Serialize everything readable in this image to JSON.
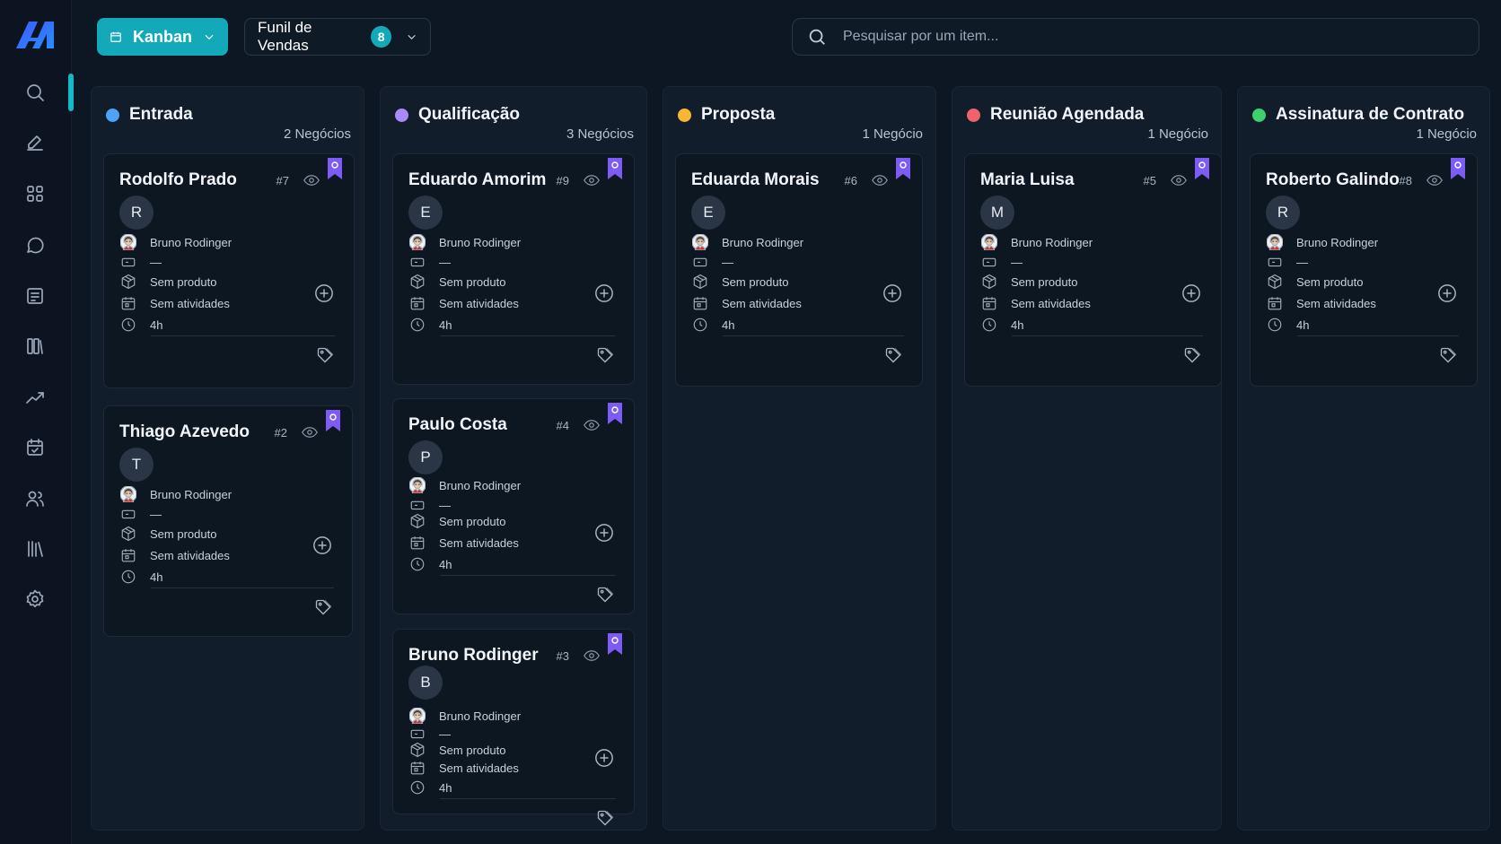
{
  "toolbar": {
    "view_label": "Kanban",
    "funnel_label": "Funil de Vendas",
    "funnel_count": "8",
    "search_placeholder": "Pesquisar por um item..."
  },
  "sidebar": {
    "items": [
      "search-icon",
      "edit-icon",
      "grid-icon",
      "chat-icon",
      "notes-icon",
      "books-icon",
      "trend-icon",
      "calendar-icon",
      "users-icon",
      "library-icon",
      "settings-icon"
    ]
  },
  "colors": {
    "accent": "#14a9b8",
    "entrada": "#4ea3f5",
    "qualificacao": "#a78bfa",
    "proposta": "#f7b733",
    "reuniao": "#f0626c",
    "assinatura": "#3ecf6f",
    "bookmark": "#7c5cf5"
  },
  "columns": [
    {
      "title": "Entrada",
      "count": "2 Negócios",
      "cards": [
        {
          "name": "Rodolfo Prado",
          "id": "#7",
          "initial": "R",
          "owner": "Bruno Rodinger",
          "dash": "—",
          "product": "Sem produto",
          "activities": "Sem atividades",
          "time": "4h"
        },
        {
          "name": "Thiago Azevedo",
          "id": "#2",
          "initial": "T",
          "owner": "Bruno Rodinger",
          "dash": "—",
          "product": "Sem produto",
          "activities": "Sem atividades",
          "time": "4h"
        }
      ]
    },
    {
      "title": "Qualificação",
      "count": "3 Negócios",
      "cards": [
        {
          "name": "Eduardo Amorim",
          "id": "#9",
          "initial": "E",
          "owner": "Bruno Rodinger",
          "dash": "—",
          "product": "Sem produto",
          "activities": "Sem atividades",
          "time": "4h"
        },
        {
          "name": "Paulo Costa",
          "id": "#4",
          "initial": "P",
          "owner": "Bruno Rodinger",
          "dash": "—",
          "product": "Sem produto",
          "activities": "Sem atividades",
          "time": "4h"
        },
        {
          "name": "Bruno Rodinger",
          "id": "#3",
          "initial": "B",
          "owner": "Bruno Rodinger",
          "dash": "—",
          "product": "Sem produto",
          "activities": "Sem atividades",
          "time": "4h"
        }
      ]
    },
    {
      "title": "Proposta",
      "count": "1 Negócio",
      "cards": [
        {
          "name": "Eduarda Morais",
          "id": "#6",
          "initial": "E",
          "owner": "Bruno Rodinger",
          "dash": "—",
          "product": "Sem produto",
          "activities": "Sem atividades",
          "time": "4h"
        }
      ]
    },
    {
      "title": "Reunião Agendada",
      "count": "1 Negócio",
      "cards": [
        {
          "name": "Maria Luisa",
          "id": "#5",
          "initial": "M",
          "owner": "Bruno Rodinger",
          "dash": "—",
          "product": "Sem produto",
          "activities": "Sem atividades",
          "time": "4h"
        }
      ]
    },
    {
      "title": "Assinatura de Contrato",
      "count": "1 Negócio",
      "cards": [
        {
          "name": "Roberto Galindo",
          "id": "#8",
          "initial": "R",
          "owner": "Bruno Rodinger",
          "dash": "—",
          "product": "Sem produto",
          "activities": "Sem atividades",
          "time": "4h"
        }
      ]
    }
  ]
}
